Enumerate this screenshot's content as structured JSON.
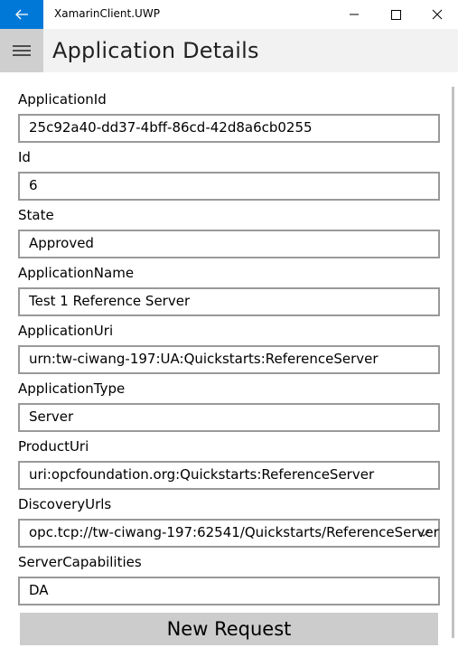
{
  "window": {
    "app_title": "XamarinClient.UWP"
  },
  "header": {
    "page_title": "Application Details"
  },
  "fields": [
    {
      "label": "ApplicationId",
      "value": "25c92a40-dd37-4bff-86cd-42d8a6cb0255"
    },
    {
      "label": "Id",
      "value": "6"
    },
    {
      "label": "State",
      "value": "Approved"
    },
    {
      "label": "ApplicationName",
      "value": "Test 1 Reference Server"
    },
    {
      "label": "ApplicationUri",
      "value": "urn:tw-ciwang-197:UA:Quickstarts:ReferenceServer"
    },
    {
      "label": "ApplicationType",
      "value": "Server"
    },
    {
      "label": "ProductUri",
      "value": "uri:opcfoundation.org:Quickstarts:ReferenceServer"
    },
    {
      "label": "DiscoveryUrls",
      "value": "opc.tcp://tw-ciwang-197:62541/Quickstarts/ReferenceServer",
      "type": "dropdown"
    },
    {
      "label": "ServerCapabilities",
      "value": "DA"
    }
  ],
  "actions": {
    "new_request_label": "New Request"
  },
  "colors": {
    "accent": "#0078d7",
    "header_bg": "#f2f2f2",
    "hamburger_bg": "#cfcfcf",
    "button_bg": "#cccccc",
    "border": "#999999"
  },
  "icons": [
    "back-arrow-icon",
    "minimize-icon",
    "maximize-icon",
    "close-icon",
    "hamburger-menu-icon",
    "chevron-down-icon"
  ]
}
